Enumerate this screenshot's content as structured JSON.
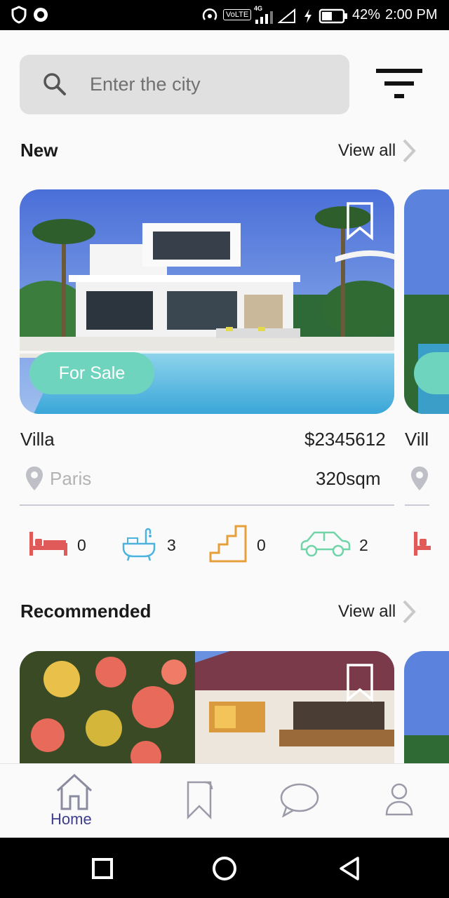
{
  "status_bar": {
    "battery": "42%",
    "time": "2:00 PM",
    "network": "VoLTE",
    "signal_type": "4G"
  },
  "search": {
    "placeholder": "Enter the city"
  },
  "sections": {
    "new": {
      "title": "New",
      "view_all": "View all"
    },
    "recommended": {
      "title": "Recommended",
      "view_all": "View all"
    }
  },
  "new_listings": [
    {
      "type": "Villa",
      "price": "$2345612",
      "location": "Paris",
      "area": "320sqm",
      "status": "For Sale",
      "features": {
        "bedrooms": "0",
        "bathrooms": "3",
        "floors": "0",
        "parking": "2"
      }
    },
    {
      "type": "Vill"
    }
  ],
  "bottom_nav": {
    "home_label": "Home"
  },
  "colors": {
    "accent": "#6fd4be",
    "bed_icon": "#e05a5a",
    "bath_icon": "#4cb3e0",
    "stairs_icon": "#e5a03a",
    "car_icon": "#6fd4a8",
    "nav_active": "#3d3d8f"
  },
  "icons": [
    "search-icon",
    "filter-icon",
    "chevron-right-icon",
    "bookmark-icon",
    "location-pin-icon",
    "bed-icon",
    "bathtub-icon",
    "stairs-icon",
    "car-icon",
    "home-icon",
    "saved-icon",
    "chat-icon",
    "profile-icon"
  ]
}
